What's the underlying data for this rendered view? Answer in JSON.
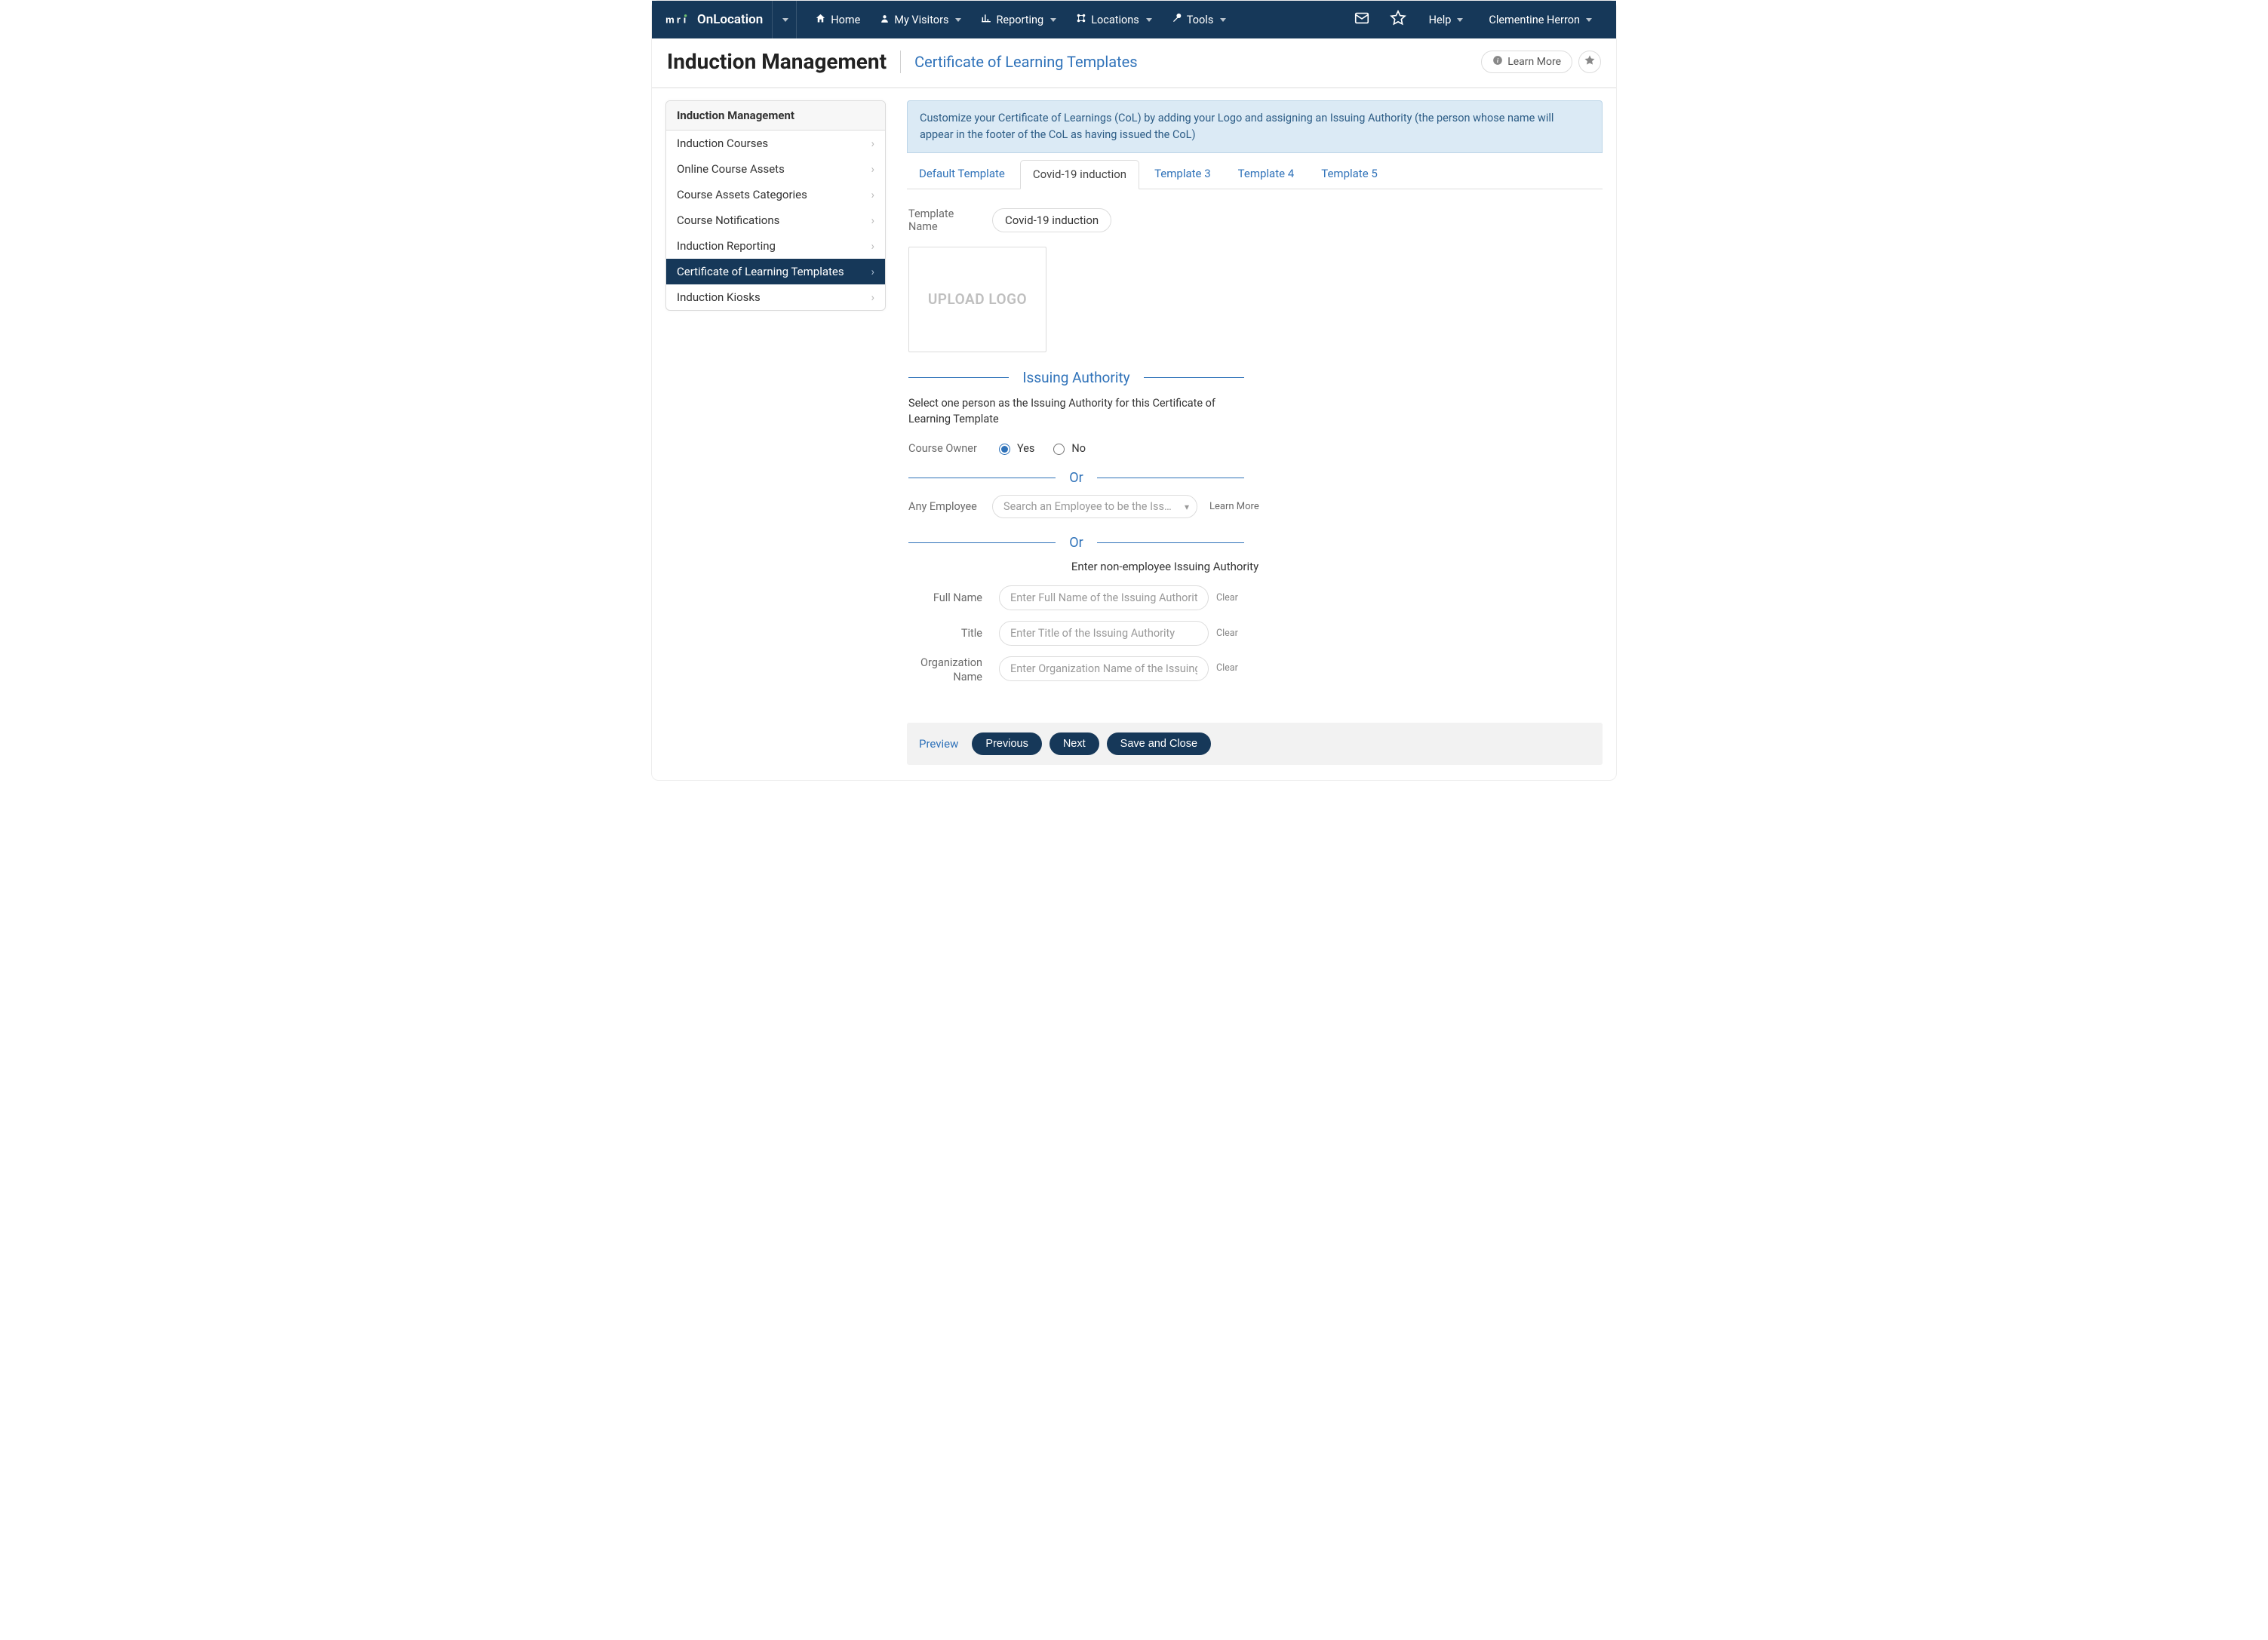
{
  "brand_name": "OnLocation",
  "nav": {
    "home": "Home",
    "visitors": "My Visitors",
    "reporting": "Reporting",
    "locations": "Locations",
    "tools": "Tools",
    "help": "Help",
    "user": "Clementine Herron"
  },
  "subheader": {
    "title": "Induction Management",
    "subtitle": "Certificate of Learning Templates",
    "learn_more": "Learn More"
  },
  "sidenav": {
    "header": "Induction Management",
    "items": [
      {
        "label": "Induction Courses"
      },
      {
        "label": "Online Course Assets"
      },
      {
        "label": "Course Assets Categories"
      },
      {
        "label": "Course Notifications"
      },
      {
        "label": "Induction Reporting"
      },
      {
        "label": "Certificate of Learning Templates"
      },
      {
        "label": "Induction Kiosks"
      }
    ],
    "active_index": 5
  },
  "info_banner": "Customize your Certificate of Learnings (CoL) by adding your Logo and assigning an Issuing Authority (the person whose name will appear in the footer of the CoL as having issued the CoL)",
  "tabs": {
    "items": [
      "Default Template",
      "Covid-19 induction",
      "Template 3",
      "Template 4",
      "Template 5"
    ],
    "active_index": 1
  },
  "form": {
    "template_name_label": "Template Name",
    "template_name_value": "Covid-19 induction",
    "upload_logo_text": "UPLOAD LOGO",
    "issuing_authority_title": "Issuing Authority",
    "issuing_authority_desc": "Select one person as the Issuing Authority for this Certificate of Learning Template",
    "course_owner_label": "Course Owner",
    "yes_label": "Yes",
    "no_label": "No",
    "course_owner_selected": "yes",
    "or_label": "Or",
    "any_employee_label": "Any Employee",
    "employee_select_placeholder": "Search an Employee to be the Issuing A…",
    "learn_more_inline": "Learn More",
    "non_employee_header": "Enter non-employee Issuing Authority",
    "full_name_label": "Full Name",
    "full_name_placeholder": "Enter Full Name of the Issuing Authority",
    "title_label": "Title",
    "title_placeholder": "Enter Title of the Issuing Authority",
    "org_label": "Organization Name",
    "org_placeholder": "Enter Organization Name of the Issuing Authority",
    "clear_label": "Clear"
  },
  "footer": {
    "preview": "Preview",
    "previous": "Previous",
    "next": "Next",
    "save_close": "Save and Close"
  }
}
